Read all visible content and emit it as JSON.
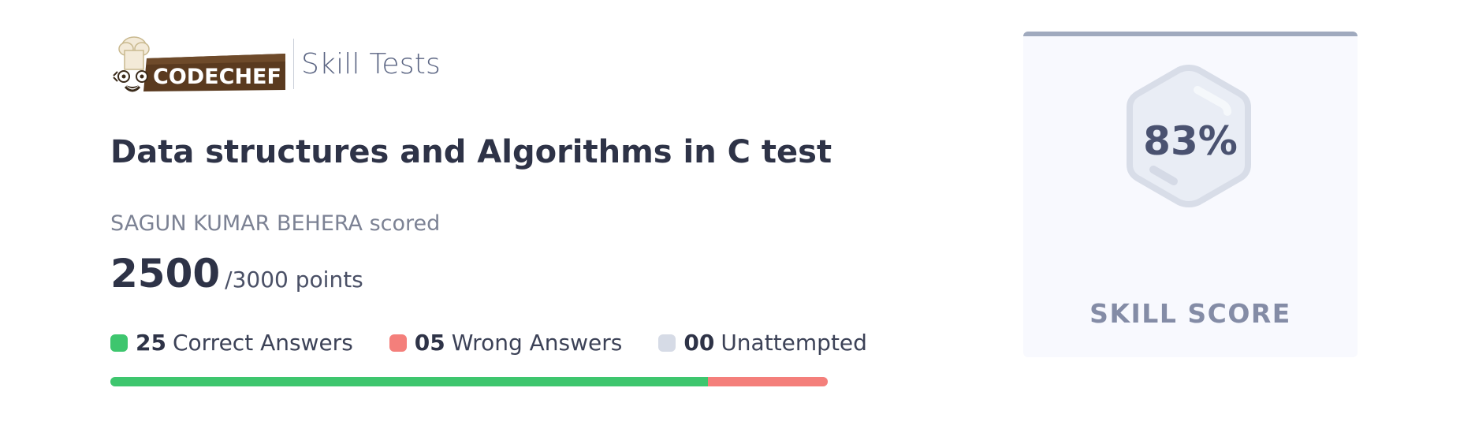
{
  "brand": {
    "logo_text": "CODECHEF",
    "product": "Skill Tests"
  },
  "test": {
    "title": "Data structures and Algorithms in C test"
  },
  "result": {
    "scored_label": "SAGUN KUMAR BEHERA scored",
    "points": "2500",
    "points_total": "/3000 points"
  },
  "stats": [
    {
      "count": "25",
      "label": "Correct Answers",
      "color": "#3ec66e"
    },
    {
      "count": "05",
      "label": "Wrong Answers",
      "color": "#f47f7b"
    },
    {
      "count": "00",
      "label": "Unattempted",
      "color": "#d6dbe6"
    }
  ],
  "progress": {
    "correct_fraction": 0.833,
    "wrong_fraction": 0.167,
    "correct_color": "#3ec66e",
    "wrong_color": "#f47f7b"
  },
  "skill_card": {
    "value": "83%",
    "label": "SKILL SCORE",
    "accent": "#a0aabe"
  }
}
